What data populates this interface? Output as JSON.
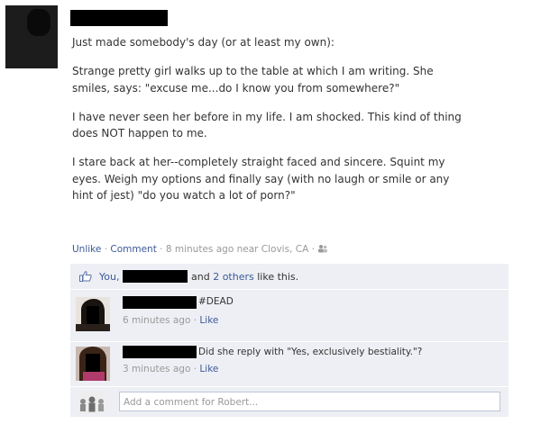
{
  "post": {
    "author_name": "",
    "paragraphs": [
      "Just made somebody's day (or at least my own):",
      "Strange pretty girl walks up to the table at which I am writing. She\nsmiles, says: \"excuse me...do I know you from somewhere?\"",
      "I have never seen her before in my life. I am shocked. This kind of thing\ndoes NOT happen to me.",
      "I stare back at her--completely straight faced and sincere. Squint my\neyes. Weigh my options and finally say (with no laugh or smile or any\nhint of jest) \"do you watch a lot of porn?\""
    ],
    "unlike_label": "Unlike",
    "comment_label": "Comment",
    "timestamp": "8 minutes ago near Clovis, CA",
    "separator": "·",
    "audience_icon": "friends-icon"
  },
  "likes": {
    "you_label": "You,",
    "and_label": "and",
    "others_link": "2 others",
    "suffix": "like this."
  },
  "comments": [
    {
      "author": "",
      "text": "#DEAD",
      "time": "6 minutes ago",
      "like_label": "Like"
    },
    {
      "author": "",
      "text": "Did she reply with \"Yes, exclusively bestiality.\"?",
      "time": "3 minutes ago",
      "like_label": "Like"
    }
  ],
  "composer": {
    "placeholder": "Add a comment for Robert..."
  },
  "colors": {
    "link": "#3b5998",
    "feed_bg": "#edeff4",
    "meta": "#999999"
  }
}
